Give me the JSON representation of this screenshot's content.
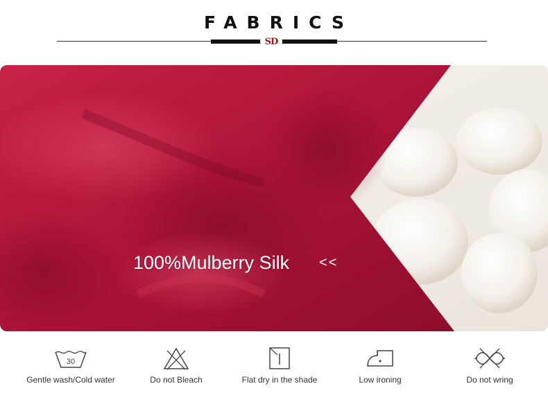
{
  "header": {
    "title": "FABRICS",
    "logo_text": "SD"
  },
  "banner": {
    "headline": "100%Mulberry Silk",
    "arrows": "<<",
    "colors": {
      "silk": "#b3163a",
      "cocoon_bg": "#f1ede7"
    }
  },
  "care": [
    {
      "icon": "wash-30-icon",
      "label": "Gentle wash/Cold water",
      "value": "30"
    },
    {
      "icon": "no-bleach-icon",
      "label": "Do not Bleach"
    },
    {
      "icon": "flat-dry-shade-icon",
      "label": "Flat dry in the shade"
    },
    {
      "icon": "low-iron-icon",
      "label": "Low ironing"
    },
    {
      "icon": "no-wring-icon",
      "label": "Do not wring"
    }
  ]
}
